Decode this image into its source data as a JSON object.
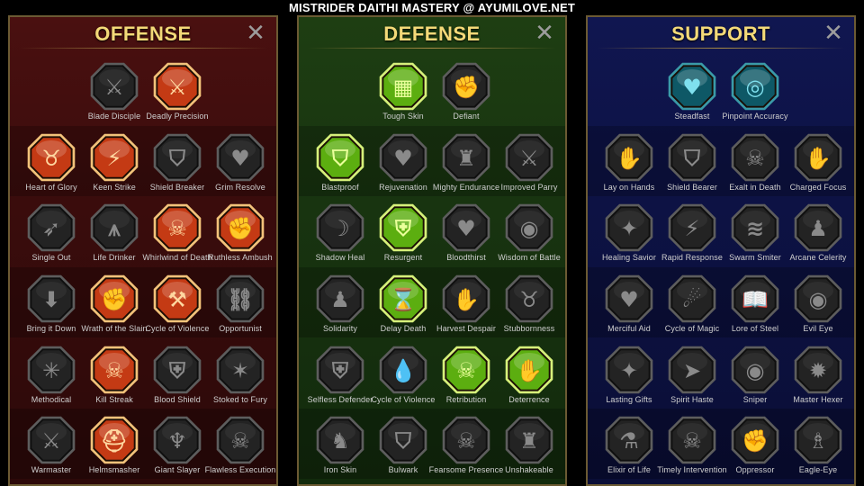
{
  "banner": "MISTRIDER DAITHI MASTERY @ AYUMILOVE.NET",
  "close_glyph": "✕",
  "panels": [
    {
      "key": "offense",
      "title": "OFFENSE",
      "rows": [
        [
          {
            "label": "Blade Disciple",
            "state": "dim",
            "icon": "crossed-swords-icon",
            "glyph": "⚔"
          },
          {
            "label": "Deadly Precision",
            "state": "active",
            "icon": "sword-strike-icon",
            "glyph": "⚔"
          }
        ],
        [
          {
            "label": "Heart of Glory",
            "state": "active",
            "icon": "horned-warrior-icon",
            "glyph": "♉"
          },
          {
            "label": "Keen Strike",
            "state": "active",
            "icon": "slash-strike-icon",
            "glyph": "⚡"
          },
          {
            "label": "Shield Breaker",
            "state": "dim",
            "icon": "broken-shield-icon",
            "glyph": "⛉"
          },
          {
            "label": "Grim Resolve",
            "state": "dim",
            "icon": "heart-horns-icon",
            "glyph": "♥"
          }
        ],
        [
          {
            "label": "Single Out",
            "state": "dim",
            "icon": "archer-icon",
            "glyph": "➶"
          },
          {
            "label": "Life Drinker",
            "state": "dim",
            "icon": "fangs-icon",
            "glyph": "⩚"
          },
          {
            "label": "Whirlwind of Death",
            "state": "active",
            "icon": "skull-slash-icon",
            "glyph": "☠"
          },
          {
            "label": "Ruthless Ambush",
            "state": "active",
            "icon": "dagger-hand-icon",
            "glyph": "✊"
          }
        ],
        [
          {
            "label": "Bring it Down",
            "state": "dim",
            "icon": "fist-down-icon",
            "glyph": "⬇"
          },
          {
            "label": "Wrath of the Slain",
            "state": "active",
            "icon": "fist-blade-icon",
            "glyph": "✊"
          },
          {
            "label": "Cycle of Violence",
            "state": "active",
            "icon": "axe-icon",
            "glyph": "⚒"
          },
          {
            "label": "Opportunist",
            "state": "dim",
            "icon": "chain-bolt-icon",
            "glyph": "⛓"
          }
        ],
        [
          {
            "label": "Methodical",
            "state": "dim",
            "icon": "spider-icon",
            "glyph": "✳"
          },
          {
            "label": "Kill Streak",
            "state": "active",
            "icon": "skull-icon",
            "glyph": "☠"
          },
          {
            "label": "Blood Shield",
            "state": "dim",
            "icon": "sword-shield-icon",
            "glyph": "⛨"
          },
          {
            "label": "Stoked to Fury",
            "state": "dim",
            "icon": "raging-man-icon",
            "glyph": "✶"
          }
        ],
        [
          {
            "label": "Warmaster",
            "state": "dim",
            "icon": "raised-sword-icon",
            "glyph": "⚔"
          },
          {
            "label": "Helmsmasher",
            "state": "active",
            "icon": "helmet-icon",
            "glyph": "⛑"
          },
          {
            "label": "Giant Slayer",
            "state": "dim",
            "icon": "demon-icon",
            "glyph": "♆"
          },
          {
            "label": "Flawless Execution",
            "state": "dim",
            "icon": "executioner-skull-icon",
            "glyph": "☠"
          }
        ]
      ]
    },
    {
      "key": "defense",
      "title": "DEFENSE",
      "rows": [
        [
          {
            "label": "Tough Skin",
            "state": "active",
            "icon": "scales-icon",
            "glyph": "▦"
          },
          {
            "label": "Defiant",
            "state": "dim",
            "icon": "raised-fist-icon",
            "glyph": "✊"
          }
        ],
        [
          {
            "label": "Blastproof",
            "state": "active",
            "icon": "chevron-shield-icon",
            "glyph": "⛉"
          },
          {
            "label": "Rejuvenation",
            "state": "dim",
            "icon": "heart-hands-icon",
            "glyph": "♥"
          },
          {
            "label": "Mighty Endurance",
            "state": "dim",
            "icon": "muscle-man-icon",
            "glyph": "♜"
          },
          {
            "label": "Improved Parry",
            "state": "dim",
            "icon": "parry-blades-icon",
            "glyph": "⚔"
          }
        ],
        [
          {
            "label": "Shadow Heal",
            "state": "dim",
            "icon": "shadow-figure-icon",
            "glyph": "☽"
          },
          {
            "label": "Resurgent",
            "state": "active",
            "icon": "knight-shield-icon",
            "glyph": "⛨"
          },
          {
            "label": "Bloodthirst",
            "state": "dim",
            "icon": "heart-skull-icon",
            "glyph": "♥"
          },
          {
            "label": "Wisdom of Battle",
            "state": "dim",
            "icon": "face-spiral-icon",
            "glyph": "◉"
          }
        ],
        [
          {
            "label": "Solidarity",
            "state": "dim",
            "icon": "crowd-icon",
            "glyph": "♟"
          },
          {
            "label": "Delay Death",
            "state": "active",
            "icon": "hourglass-icon",
            "glyph": "⌛"
          },
          {
            "label": "Harvest Despair",
            "state": "dim",
            "icon": "open-hand-icon",
            "glyph": "✋"
          },
          {
            "label": "Stubbornness",
            "state": "dim",
            "icon": "bull-icon",
            "glyph": "♉"
          }
        ],
        [
          {
            "label": "Selfless Defender",
            "state": "dim",
            "icon": "defender-icon",
            "glyph": "⛨"
          },
          {
            "label": "Cycle of Violence",
            "state": "dim",
            "icon": "drops-icon",
            "glyph": "💧"
          },
          {
            "label": "Retribution",
            "state": "active",
            "icon": "skull-burst-icon",
            "glyph": "☠"
          },
          {
            "label": "Deterrence",
            "state": "active",
            "icon": "hand-shield-icon",
            "glyph": "✋"
          }
        ],
        [
          {
            "label": "Iron Skin",
            "state": "dim",
            "icon": "warrior-icon",
            "glyph": "♞"
          },
          {
            "label": "Bulwark",
            "state": "dim",
            "icon": "shield-icon",
            "glyph": "⛉"
          },
          {
            "label": "Fearsome Presence",
            "state": "dim",
            "icon": "hooded-skull-icon",
            "glyph": "☠"
          },
          {
            "label": "Unshakeable",
            "state": "dim",
            "icon": "strongman-icon",
            "glyph": "♜"
          }
        ]
      ]
    },
    {
      "key": "support",
      "title": "SUPPORT",
      "rows": [
        [
          {
            "label": "Steadfast",
            "state": "active",
            "icon": "heart-hands-icon",
            "glyph": "♥"
          },
          {
            "label": "Pinpoint Accuracy",
            "state": "active",
            "icon": "target-icon",
            "glyph": "◎"
          }
        ],
        [
          {
            "label": "Lay on Hands",
            "state": "dim",
            "icon": "praying-hands-icon",
            "glyph": "✋"
          },
          {
            "label": "Shield Bearer",
            "state": "dim",
            "icon": "shield-arcs-icon",
            "glyph": "⛉"
          },
          {
            "label": "Exalt in Death",
            "state": "dim",
            "icon": "skull-flame-icon",
            "glyph": "☠"
          },
          {
            "label": "Charged Focus",
            "state": "dim",
            "icon": "beam-hand-icon",
            "glyph": "✋"
          }
        ],
        [
          {
            "label": "Healing Savior",
            "state": "dim",
            "icon": "sparkle-man-icon",
            "glyph": "✦"
          },
          {
            "label": "Rapid Response",
            "state": "dim",
            "icon": "lightning-icon",
            "glyph": "⚡"
          },
          {
            "label": "Swarm Smiter",
            "state": "dim",
            "icon": "wave-strike-icon",
            "glyph": "≋"
          },
          {
            "label": "Arcane Celerity",
            "state": "dim",
            "icon": "running-man-icon",
            "glyph": "♟"
          }
        ],
        [
          {
            "label": "Merciful Aid",
            "state": "dim",
            "icon": "chained-heart-icon",
            "glyph": "♥"
          },
          {
            "label": "Cycle of Magic",
            "state": "dim",
            "icon": "fireball-icon",
            "glyph": "☄"
          },
          {
            "label": "Lore of Steel",
            "state": "dim",
            "icon": "book-icon",
            "glyph": "📖"
          },
          {
            "label": "Evil Eye",
            "state": "dim",
            "icon": "evil-eye-icon",
            "glyph": "◉"
          }
        ],
        [
          {
            "label": "Lasting Gifts",
            "state": "dim",
            "icon": "star-compass-icon",
            "glyph": "✦"
          },
          {
            "label": "Spirit Haste",
            "state": "dim",
            "icon": "winged-boot-icon",
            "glyph": "➤"
          },
          {
            "label": "Sniper",
            "state": "dim",
            "icon": "eye-icon",
            "glyph": "◉"
          },
          {
            "label": "Master Hexer",
            "state": "dim",
            "icon": "hexer-icon",
            "glyph": "✹"
          }
        ],
        [
          {
            "label": "Elixir of Life",
            "state": "dim",
            "icon": "potion-icon",
            "glyph": "⚗"
          },
          {
            "label": "Timely Intervention",
            "state": "dim",
            "icon": "hooded-skull-icon",
            "glyph": "☠"
          },
          {
            "label": "Oppressor",
            "state": "dim",
            "icon": "fist-crush-icon",
            "glyph": "✊"
          },
          {
            "label": "Eagle-Eye",
            "state": "dim",
            "icon": "eagle-icon",
            "glyph": "♗"
          }
        ]
      ]
    }
  ],
  "colors": {
    "offense_active_outer": "#f2c27a",
    "offense_active_inner": "#c43a14",
    "defense_active_outer": "#d6f07a",
    "defense_active_inner": "#5cae10",
    "support_active_outer": "#3a9aa8",
    "support_active_inner": "#0e5866",
    "dim_outer": "#5d5d5d",
    "dim_inner": "#232323",
    "title": "#f3d978"
  }
}
